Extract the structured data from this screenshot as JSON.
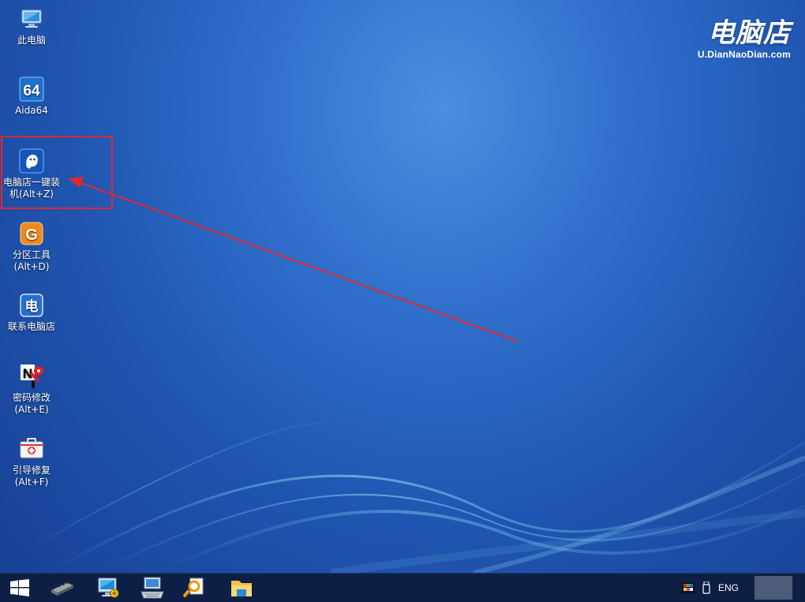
{
  "desktop": {
    "icons": [
      {
        "label": "此电脑",
        "icon": "this-pc-icon"
      },
      {
        "label": "Aida64",
        "icon": "aida64-icon",
        "glyph": "64"
      },
      {
        "label": "电脑店一键装\n机(Alt+Z)",
        "icon": "ghost-installer-icon"
      },
      {
        "label": "分区工具\n(Alt+D)",
        "icon": "partition-tool-icon",
        "glyph": "G"
      },
      {
        "label": "联系电脑店",
        "icon": "contact-icon",
        "glyph": "电"
      },
      {
        "label": "密码修改\n(Alt+E)",
        "icon": "password-key-icon",
        "glyph": "N"
      },
      {
        "label": "引导修复\n(Alt+F)",
        "icon": "boot-repair-kit-icon"
      }
    ],
    "highlight_color": "#e3272f"
  },
  "brand": {
    "name": "电脑店",
    "url": "U.DianNaoDian.com"
  },
  "taskbar": {
    "buttons": [
      "start-icon",
      "memory-module-icon",
      "network-computer-icon",
      "keyboard-monitor-icon",
      "search-file-icon",
      "file-explorer-icon"
    ],
    "tray": {
      "language": "ENG",
      "icons": [
        "color-display-icon",
        "usb-drive-icon"
      ]
    }
  },
  "colors": {
    "desktop_bg": "#2f6fcb",
    "taskbar_bg": "#0e1f46",
    "accent_red": "#e3272f"
  }
}
